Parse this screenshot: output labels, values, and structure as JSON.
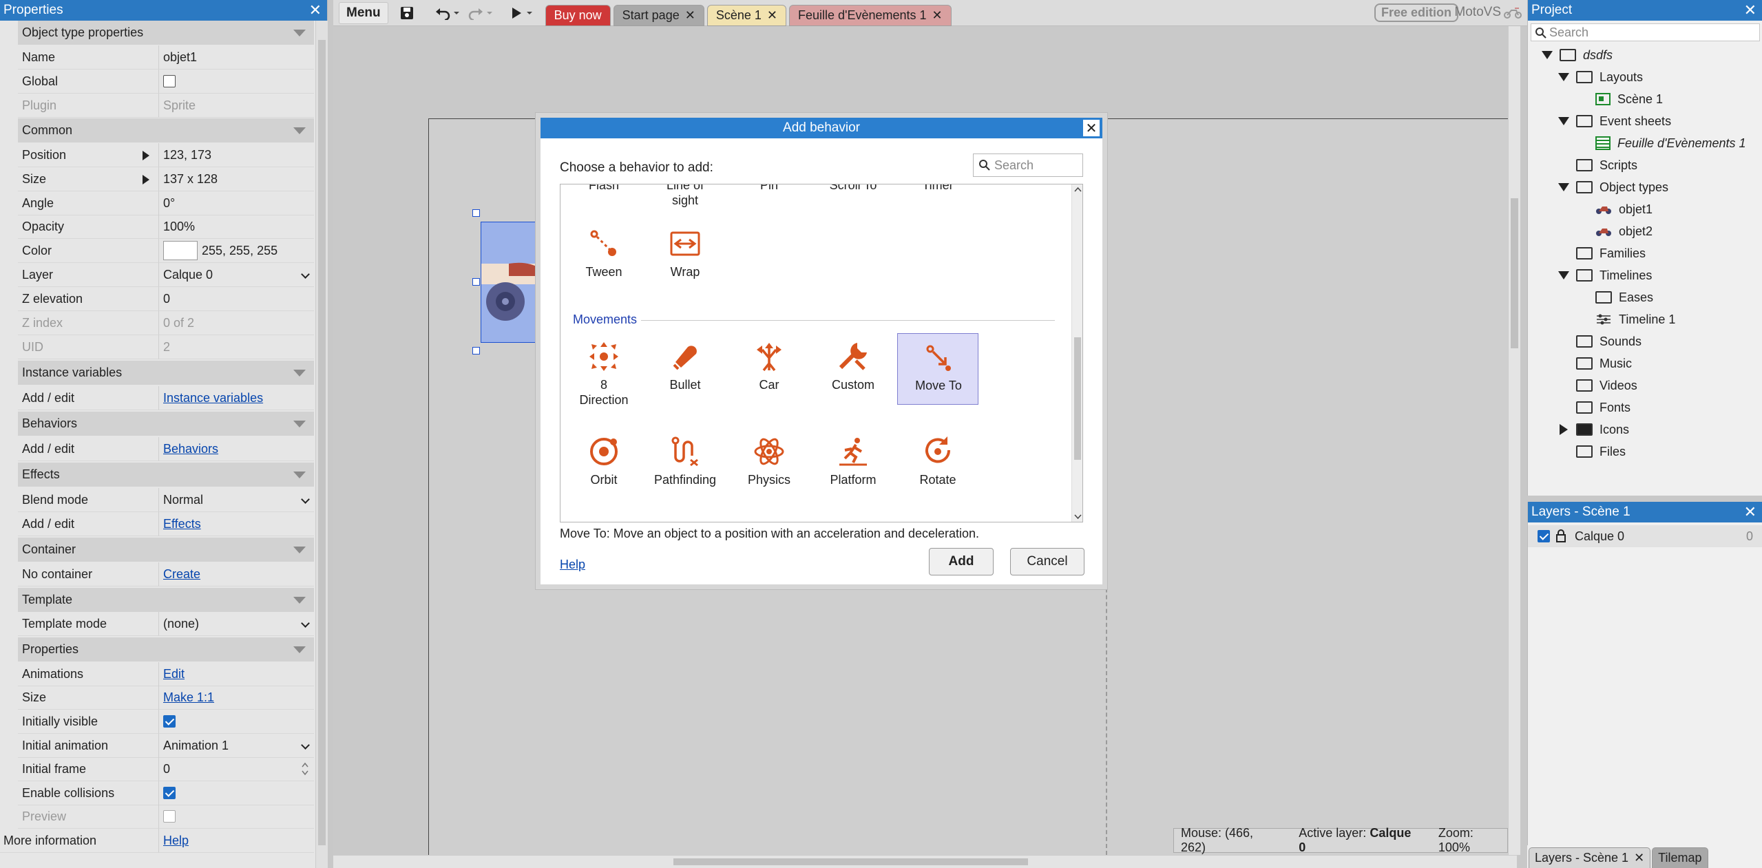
{
  "properties_panel": {
    "title": "Properties",
    "rows": [
      {
        "type": "cat",
        "label": "Object type properties"
      },
      {
        "type": "text",
        "label": "Name",
        "value": "objet1"
      },
      {
        "type": "check",
        "label": "Global",
        "checked": false
      },
      {
        "type": "text",
        "label": "Plugin",
        "value": "Sprite",
        "disabled": true
      },
      {
        "type": "cat",
        "label": "Common"
      },
      {
        "type": "expand",
        "label": "Position",
        "value": "123, 173"
      },
      {
        "type": "expand",
        "label": "Size",
        "value": "137 x 128"
      },
      {
        "type": "text",
        "label": "Angle",
        "value": "0°"
      },
      {
        "type": "text",
        "label": "Opacity",
        "value": "100%"
      },
      {
        "type": "color",
        "label": "Color",
        "value": "255, 255, 255"
      },
      {
        "type": "dropdown",
        "label": "Layer",
        "value": "Calque 0"
      },
      {
        "type": "text",
        "label": "Z elevation",
        "value": "0"
      },
      {
        "type": "text",
        "label": "Z index",
        "value": "0 of 2",
        "disabled": true
      },
      {
        "type": "text",
        "label": "UID",
        "value": "2",
        "disabled": true
      },
      {
        "type": "cat",
        "label": "Instance variables"
      },
      {
        "type": "link",
        "label": "Add / edit",
        "value": "Instance variables"
      },
      {
        "type": "cat",
        "label": "Behaviors"
      },
      {
        "type": "link",
        "label": "Add / edit",
        "value": "Behaviors"
      },
      {
        "type": "cat",
        "label": "Effects"
      },
      {
        "type": "dropdown",
        "label": "Blend mode",
        "value": "Normal"
      },
      {
        "type": "link",
        "label": "Add / edit",
        "value": "Effects"
      },
      {
        "type": "cat",
        "label": "Container"
      },
      {
        "type": "link",
        "label": "No container",
        "value": "Create"
      },
      {
        "type": "cat",
        "label": "Template"
      },
      {
        "type": "dropdown",
        "label": "Template mode",
        "value": "(none)"
      },
      {
        "type": "cat",
        "label": "Properties"
      },
      {
        "type": "link",
        "label": "Animations",
        "value": "Edit"
      },
      {
        "type": "link",
        "label": "Size",
        "value": "Make 1:1"
      },
      {
        "type": "check",
        "label": "Initially visible",
        "checked": true
      },
      {
        "type": "dropdown",
        "label": "Initial animation",
        "value": "Animation 1"
      },
      {
        "type": "spin",
        "label": "Initial frame",
        "value": "0"
      },
      {
        "type": "check",
        "label": "Enable collisions",
        "checked": true
      },
      {
        "type": "check",
        "label": "Preview",
        "checked": false,
        "disabled": true
      }
    ],
    "more_info_label": "More information",
    "more_info_link": "Help"
  },
  "toolbar": {
    "menu_label": "Menu",
    "tabs": [
      {
        "id": "tab-buy",
        "label": "Buy now",
        "closable": false
      },
      {
        "id": "tab-start",
        "label": "Start page",
        "closable": true
      },
      {
        "id": "tab-scene",
        "label": "Scène 1",
        "closable": true
      },
      {
        "id": "tab-events",
        "label": "Feuille d'Evènements 1",
        "closable": true
      }
    ],
    "free_edition": "Free edition",
    "app_name": "MotoVS"
  },
  "status": {
    "mouse": "Mouse: (466, 262)",
    "active_layer_label": "Active layer:",
    "active_layer_value": "Calque 0",
    "zoom": "Zoom: 100%"
  },
  "project_panel": {
    "title": "Project",
    "search_placeholder": "Search",
    "tree": [
      {
        "label": "dsdfs",
        "level": 0,
        "expand": "down",
        "icon": "folder",
        "italic": true
      },
      {
        "label": "Layouts",
        "level": 1,
        "expand": "down",
        "icon": "folder"
      },
      {
        "label": "Scène 1",
        "level": 2,
        "expand": "none",
        "icon": "layout"
      },
      {
        "label": "Event sheets",
        "level": 1,
        "expand": "down",
        "icon": "folder"
      },
      {
        "label": "Feuille d'Evènements 1",
        "level": 2,
        "expand": "none",
        "icon": "events",
        "italic": true
      },
      {
        "label": "Scripts",
        "level": 1,
        "expand": "none",
        "icon": "folder"
      },
      {
        "label": "Object types",
        "level": 1,
        "expand": "down",
        "icon": "folder"
      },
      {
        "label": "objet1",
        "level": 2,
        "expand": "none",
        "icon": "object"
      },
      {
        "label": "objet2",
        "level": 2,
        "expand": "none",
        "icon": "object"
      },
      {
        "label": "Families",
        "level": 1,
        "expand": "none",
        "icon": "folder"
      },
      {
        "label": "Timelines",
        "level": 1,
        "expand": "down",
        "icon": "folder"
      },
      {
        "label": "Eases",
        "level": 2,
        "expand": "none",
        "icon": "folder"
      },
      {
        "label": "Timeline 1",
        "level": 2,
        "expand": "none",
        "icon": "timeline"
      },
      {
        "label": "Sounds",
        "level": 1,
        "expand": "none",
        "icon": "folder"
      },
      {
        "label": "Music",
        "level": 1,
        "expand": "none",
        "icon": "folder"
      },
      {
        "label": "Videos",
        "level": 1,
        "expand": "none",
        "icon": "folder"
      },
      {
        "label": "Fonts",
        "level": 1,
        "expand": "none",
        "icon": "folder"
      },
      {
        "label": "Icons",
        "level": 1,
        "expand": "right",
        "icon": "folder-filled"
      },
      {
        "label": "Files",
        "level": 1,
        "expand": "none",
        "icon": "folder"
      }
    ]
  },
  "layers_panel": {
    "title": "Layers - Scène 1",
    "layer_name": "Calque 0",
    "layer_count": "0",
    "bottom_tabs": [
      "Layers - Scène 1",
      "Tilemap"
    ]
  },
  "dialog": {
    "title": "Add behavior",
    "choose_label": "Choose a behavior to add:",
    "search_placeholder": "Search",
    "cut_items": [
      "Flash",
      "Line of sight",
      "Pin",
      "Scroll To",
      "Timer"
    ],
    "general_items": [
      "Tween",
      "Wrap"
    ],
    "movements_header": "Movements",
    "movement_row1": [
      "8 Direction",
      "Bullet",
      "Car",
      "Custom",
      "Move To"
    ],
    "movement_row2": [
      "Orbit",
      "Pathfinding",
      "Physics",
      "Platform",
      "Rotate"
    ],
    "selected": "Move To",
    "description": "Move To: Move an object to a position with an acceleration and deceleration.",
    "help_label": "Help",
    "add_label": "Add",
    "cancel_label": "Cancel"
  },
  "colors": {
    "accent": "#2b79c2",
    "icon_orange": "#d8541e",
    "buy_tab": "#cf3838",
    "selection": "#dcdcf8"
  }
}
